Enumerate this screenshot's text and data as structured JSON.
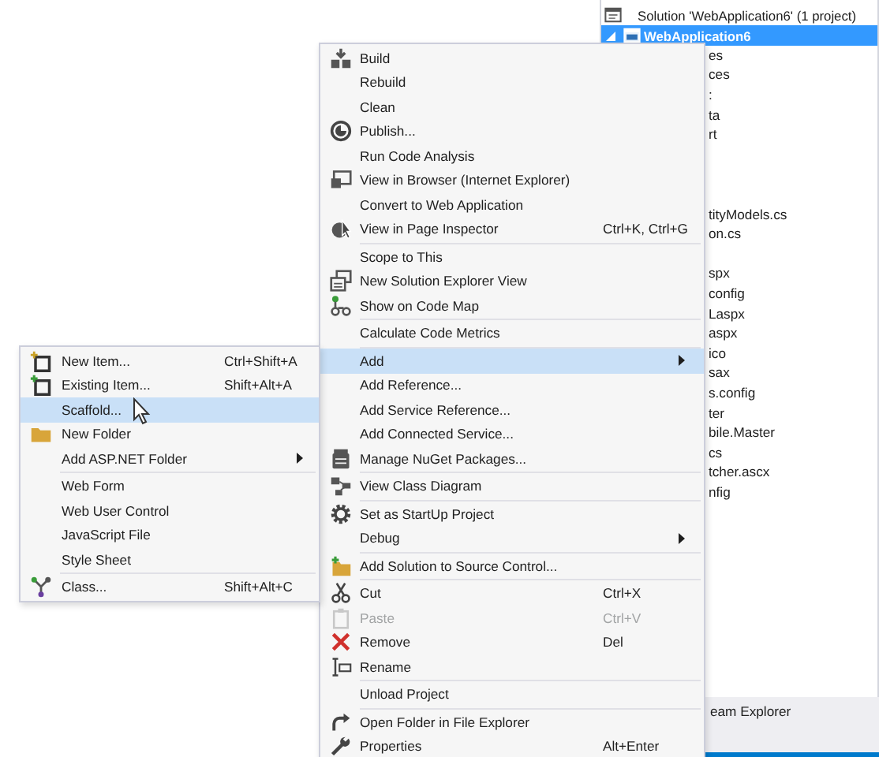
{
  "solution_explorer": {
    "rows": [
      {
        "label": "Solution 'WebApplication6' (1 project)",
        "selected": false
      },
      {
        "label": "WebApplication6",
        "selected": true,
        "expanded": true
      }
    ],
    "fragment_groups": [
      [
        "es",
        "ces",
        ":",
        "ta",
        "rt"
      ],
      [
        "tityModels.cs",
        "on.cs"
      ],
      [
        "spx",
        "config",
        "Laspx",
        "aspx",
        "ico",
        "sax",
        "s.config",
        "ter",
        "bile.Master",
        "cs",
        "tcher.ascx",
        "nfig"
      ]
    ],
    "bottom_tab": "eam Explorer"
  },
  "context_menu": {
    "items": [
      {
        "kind": "item",
        "label": "Build",
        "selected": false,
        "disabled": false,
        "submenu": false
      },
      {
        "kind": "item",
        "label": "Rebuild",
        "selected": false,
        "disabled": false,
        "submenu": false
      },
      {
        "kind": "item",
        "label": "Clean",
        "selected": false,
        "disabled": false,
        "submenu": false
      },
      {
        "kind": "item",
        "label": "Publish...",
        "selected": false,
        "disabled": false,
        "submenu": false
      },
      {
        "kind": "item",
        "label": "Run Code Analysis",
        "selected": false,
        "disabled": false,
        "submenu": false
      },
      {
        "kind": "item",
        "label": "View in Browser (Internet Explorer)",
        "selected": false,
        "disabled": false,
        "submenu": false
      },
      {
        "kind": "item",
        "label": "Convert to Web Application",
        "selected": false,
        "disabled": false,
        "submenu": false
      },
      {
        "kind": "item",
        "label": "View in Page Inspector",
        "shortcut": "Ctrl+K, Ctrl+G",
        "selected": false,
        "disabled": false,
        "submenu": false
      },
      {
        "kind": "separator"
      },
      {
        "kind": "item",
        "label": "Scope to This",
        "selected": false,
        "disabled": false,
        "submenu": false
      },
      {
        "kind": "item",
        "label": "New Solution Explorer View",
        "selected": false,
        "disabled": false,
        "submenu": false
      },
      {
        "kind": "item",
        "label": "Show on Code Map",
        "selected": false,
        "disabled": false,
        "submenu": false
      },
      {
        "kind": "separator"
      },
      {
        "kind": "item",
        "label": "Calculate Code Metrics",
        "selected": false,
        "disabled": false,
        "submenu": false
      },
      {
        "kind": "separator"
      },
      {
        "kind": "item",
        "label": "Add",
        "selected": true,
        "disabled": false,
        "submenu": true
      },
      {
        "kind": "item",
        "label": "Add Reference...",
        "selected": false,
        "disabled": false,
        "submenu": false
      },
      {
        "kind": "item",
        "label": "Add Service Reference...",
        "selected": false,
        "disabled": false,
        "submenu": false
      },
      {
        "kind": "item",
        "label": "Add Connected Service...",
        "selected": false,
        "disabled": false,
        "submenu": false
      },
      {
        "kind": "item",
        "label": "Manage NuGet Packages...",
        "selected": false,
        "disabled": false,
        "submenu": false
      },
      {
        "kind": "separator"
      },
      {
        "kind": "item",
        "label": "View Class Diagram",
        "selected": false,
        "disabled": false,
        "submenu": false
      },
      {
        "kind": "separator"
      },
      {
        "kind": "item",
        "label": "Set as StartUp Project",
        "selected": false,
        "disabled": false,
        "submenu": false
      },
      {
        "kind": "item",
        "label": "Debug",
        "selected": false,
        "disabled": false,
        "submenu": true
      },
      {
        "kind": "separator"
      },
      {
        "kind": "item",
        "label": "Add Solution to Source Control...",
        "selected": false,
        "disabled": false,
        "submenu": false
      },
      {
        "kind": "separator"
      },
      {
        "kind": "item",
        "label": "Cut",
        "shortcut": "Ctrl+X",
        "selected": false,
        "disabled": false,
        "submenu": false
      },
      {
        "kind": "item",
        "label": "Paste",
        "shortcut": "Ctrl+V",
        "selected": false,
        "disabled": true,
        "submenu": false
      },
      {
        "kind": "item",
        "label": "Remove",
        "shortcut": "Del",
        "selected": false,
        "disabled": false,
        "submenu": false
      },
      {
        "kind": "item",
        "label": "Rename",
        "selected": false,
        "disabled": false,
        "submenu": false
      },
      {
        "kind": "separator"
      },
      {
        "kind": "item",
        "label": "Unload Project",
        "selected": false,
        "disabled": false,
        "submenu": false
      },
      {
        "kind": "separator"
      },
      {
        "kind": "item",
        "label": "Open Folder in File Explorer",
        "selected": false,
        "disabled": false,
        "submenu": false
      },
      {
        "kind": "item",
        "label": "Properties",
        "shortcut": "Alt+Enter",
        "selected": false,
        "disabled": false,
        "submenu": false
      }
    ]
  },
  "add_submenu": {
    "items": [
      {
        "kind": "item",
        "label": "New Item...",
        "shortcut": "Ctrl+Shift+A",
        "selected": false,
        "disabled": false,
        "submenu": false
      },
      {
        "kind": "item",
        "label": "Existing Item...",
        "shortcut": "Shift+Alt+A",
        "selected": false,
        "disabled": false,
        "submenu": false
      },
      {
        "kind": "item",
        "label": "Scaffold...",
        "selected": true,
        "disabled": false,
        "submenu": false
      },
      {
        "kind": "item",
        "label": "New Folder",
        "selected": false,
        "disabled": false,
        "submenu": false
      },
      {
        "kind": "item",
        "label": "Add ASP.NET Folder",
        "selected": false,
        "disabled": false,
        "submenu": true
      },
      {
        "kind": "separator"
      },
      {
        "kind": "item",
        "label": "Web Form",
        "selected": false,
        "disabled": false,
        "submenu": false
      },
      {
        "kind": "item",
        "label": "Web User Control",
        "selected": false,
        "disabled": false,
        "submenu": false
      },
      {
        "kind": "item",
        "label": "JavaScript File",
        "selected": false,
        "disabled": false,
        "submenu": false
      },
      {
        "kind": "item",
        "label": "Style Sheet",
        "selected": false,
        "disabled": false,
        "submenu": false
      },
      {
        "kind": "separator"
      },
      {
        "kind": "item",
        "label": "Class...",
        "shortcut": "Shift+Alt+C",
        "selected": false,
        "disabled": false,
        "submenu": false
      }
    ]
  }
}
